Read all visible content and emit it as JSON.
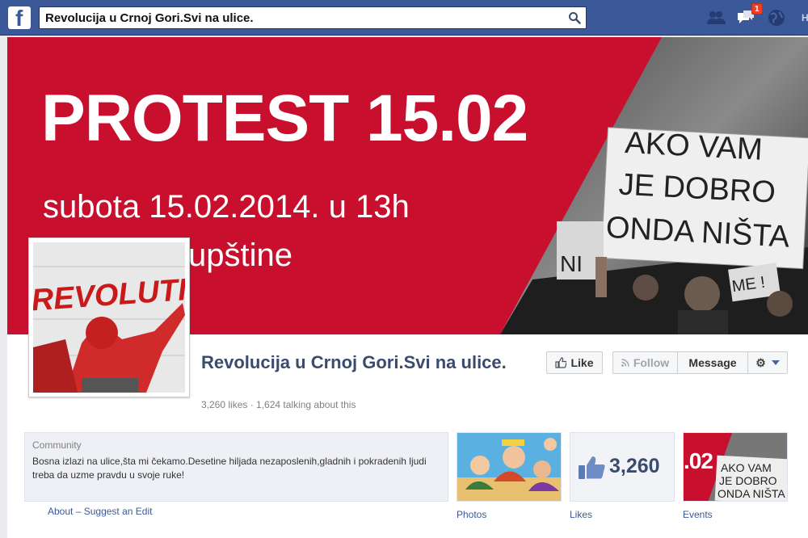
{
  "topbar": {
    "search_value": "Revolucija u Crnoj Gori.Svi na ulice.",
    "notification_count": "1",
    "home_initial": "H"
  },
  "cover": {
    "headline": "PROTEST 15.02",
    "date_line": "subota 15.02.2014. u 13h",
    "location_fragment": "upštine",
    "sign_lines": [
      "AKO VAM",
      "JE DOBRO",
      "ONDA NIŠTA"
    ],
    "sign_fragments": [
      "NI",
      "ME !"
    ]
  },
  "profile": {
    "graffiti": "REVOLUTIO"
  },
  "header": {
    "name": "Revolucija u Crnoj Gori.Svi na ulice.",
    "stats": "3,260 likes · 1,624 talking about this"
  },
  "actions": {
    "like_label": "Like",
    "follow_label": "Follow",
    "message_label": "Message"
  },
  "about": {
    "category": "Community",
    "description": "Bosna izlazi na ulice,šta mi čekamo.Desetine hiljada nezaposlenih,gladnih i pokradenih ljudi treba da uzme pravdu u svoje ruke!",
    "about_link": "About",
    "separator": "–",
    "edit_link": "Suggest an Edit"
  },
  "tiles": {
    "photos_label": "Photos",
    "likes_label": "Likes",
    "likes_count": "3,260",
    "events_label": "Events",
    "event_thumb_text": ".02",
    "event_sign_lines": [
      "AKO VAM",
      "JE DOBRO",
      "ONDA NIŠTA"
    ]
  },
  "colors": {
    "brand_blue": "#3b5998",
    "cover_red": "#c8102e",
    "badge_red": "#f03d25"
  },
  "icons": [
    "facebook-logo-icon",
    "search-icon",
    "friend-requests-icon",
    "messages-icon",
    "globe-icon",
    "thumbs-up-icon",
    "rss-icon",
    "gear-icon",
    "chevron-down-icon"
  ]
}
